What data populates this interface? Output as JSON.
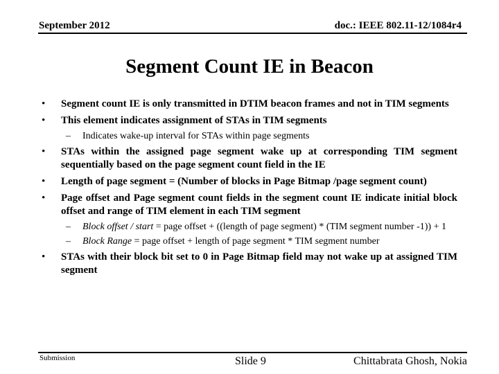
{
  "header": {
    "date": "September 2012",
    "doc_id": "doc.: IEEE 802.11-12/1084r4"
  },
  "title": "Segment Count IE in Beacon",
  "bullet_glyph": "•",
  "dash_glyph": "–",
  "bullets": [
    {
      "text": "Segment count IE is only transmitted in DTIM beacon frames and not in TIM segments"
    },
    {
      "text": "This element indicates assignment of STAs in TIM segments",
      "sub": [
        {
          "text": "Indicates wake-up interval for STAs within page segments"
        }
      ]
    },
    {
      "text": "STAs within the assigned page segment wake up at corresponding TIM segment sequentially based on the page segment count field in the IE"
    },
    {
      "text": "Length of page segment = (Number of blocks in Page Bitmap /page segment count)"
    },
    {
      "text": "Page offset and Page segment count fields in the segment count IE indicate initial block offset and range of TIM element in each TIM segment",
      "sub": [
        {
          "term": "Block offset / start",
          "text": " = page offset + ((length of page segment) * (TIM segment number -1)) + 1"
        },
        {
          "term": "Block Range",
          "text": " = page offset + length of page segment * TIM segment number"
        }
      ]
    },
    {
      "text": "STAs with their block bit set to 0 in Page Bitmap field may not wake up at assigned TIM segment"
    }
  ],
  "footer": {
    "left": "Submission",
    "center": "Slide 9",
    "right": "Chittabrata Ghosh, Nokia"
  }
}
